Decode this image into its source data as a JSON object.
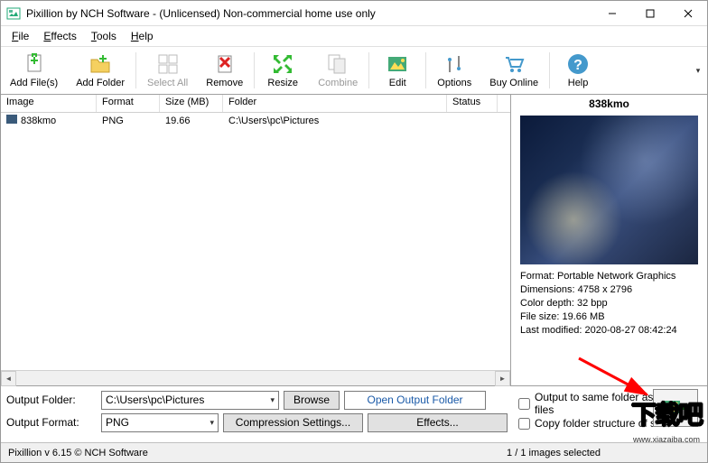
{
  "title": "Pixillion by NCH Software - (Unlicensed) Non-commercial home use only",
  "menu": {
    "file": "File",
    "effects": "Effects",
    "tools": "Tools",
    "help": "Help"
  },
  "toolbar": {
    "add_files": "Add File(s)",
    "add_folder": "Add Folder",
    "select_all": "Select All",
    "remove": "Remove",
    "resize": "Resize",
    "combine": "Combine",
    "edit": "Edit",
    "options": "Options",
    "buy_online": "Buy Online",
    "help": "Help"
  },
  "columns": {
    "image": "Image",
    "format": "Format",
    "size": "Size (MB)",
    "folder": "Folder",
    "status": "Status"
  },
  "row": {
    "name": "838kmo",
    "format": "PNG",
    "size": "19.66",
    "folder": "C:\\Users\\pc\\Pictures"
  },
  "preview": {
    "filename": "838kmo",
    "fmt_line": "Format: Portable Network Graphics",
    "dim_line": "Dimensions: 4758 x 2796",
    "depth_line": "Color depth: 32 bpp",
    "size_line": "File size: 19.66 MB",
    "mod_line": "Last modified: 2020-08-27 08:42:24"
  },
  "form": {
    "output_folder_label": "Output Folder:",
    "output_folder_value": "C:\\Users\\pc\\Pictures",
    "browse": "Browse",
    "open_output": "Open Output Folder",
    "output_format_label": "Output Format:",
    "output_format_value": "PNG",
    "compression": "Compression Settings...",
    "effects": "Effects...",
    "opt_same_folder": "Output to same folder as source files",
    "opt_copy_structure": "Copy folder structure of so"
  },
  "status": {
    "left": "Pixillion v 6.15 © NCH Software",
    "right": "1 / 1 images selected"
  },
  "overlay": "下载吧"
}
